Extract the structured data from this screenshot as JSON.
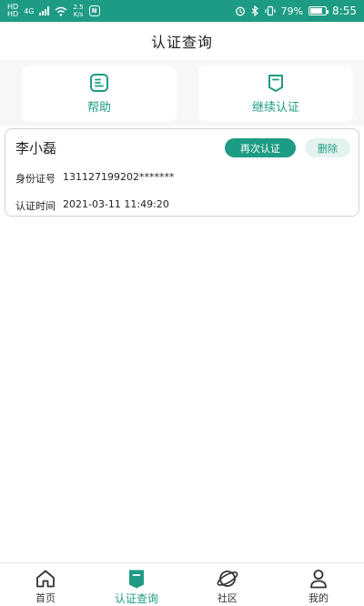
{
  "status_bar": {
    "net_top": "HD",
    "net_bottom": "HD",
    "net_4g": "4G",
    "speed_value": "2.5",
    "speed_unit": "K/s",
    "nfc": "N",
    "battery": "79%",
    "battery_level": 0.79,
    "time": "8:55"
  },
  "header": {
    "title": "认证查询"
  },
  "actions": [
    {
      "label": "帮助",
      "icon": "help-doc-icon"
    },
    {
      "label": "继续认证",
      "icon": "continue-verify-icon"
    }
  ],
  "record": {
    "name": "李小磊",
    "reverify_label": "再次认证",
    "delete_label": "删除",
    "id_label": "身份证号",
    "id_value": "131127199202*******",
    "time_label": "认证时间",
    "time_value": "2021-03-11 11:49:20"
  },
  "tabs": [
    {
      "label": "首页",
      "icon": "home-icon",
      "active": false
    },
    {
      "label": "认证查询",
      "icon": "verify-query-icon",
      "active": true
    },
    {
      "label": "社区",
      "icon": "planet-icon",
      "active": false
    },
    {
      "label": "我的",
      "icon": "user-icon",
      "active": false
    }
  ],
  "colors": {
    "accent": "#1d9b84",
    "accent_light": "#e4f3ef",
    "tab_inactive": "#333333"
  }
}
